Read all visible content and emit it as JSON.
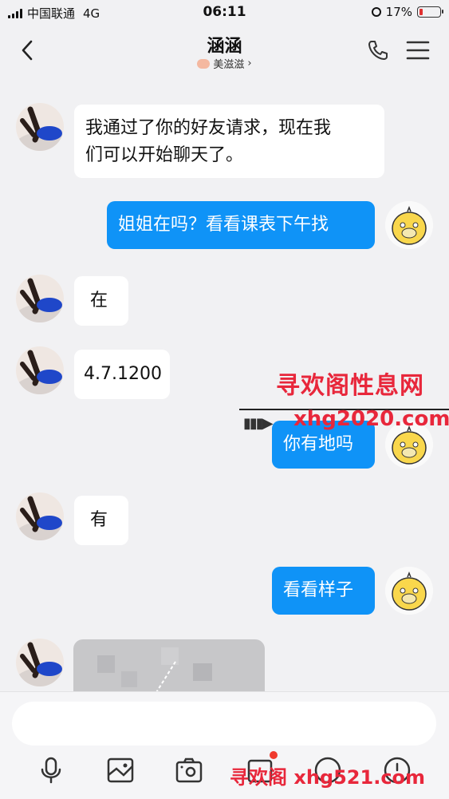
{
  "status_bar": {
    "carrier": "中国联通",
    "network": "4G",
    "time": "06:11",
    "battery": "17%",
    "battery_level": 0.17
  },
  "header": {
    "title": "涵涵",
    "subtitle": "美滋滋",
    "subtitle_chevron": "›"
  },
  "messages": [
    {
      "side": "in",
      "lines": [
        "我通过了你的好友请求，现在我",
        "们可以开始聊天了。"
      ]
    },
    {
      "side": "out",
      "text": "姐姐在吗？看看课表下午找"
    },
    {
      "side": "in",
      "text": "在"
    },
    {
      "side": "in",
      "text": "4.7.1200"
    },
    {
      "side": "out",
      "text": "你有地吗"
    },
    {
      "side": "in",
      "text": "有"
    },
    {
      "side": "out",
      "text": "看看样子"
    },
    {
      "side": "in",
      "type": "image"
    }
  ],
  "watermarks": {
    "cn": "寻欢阁性息网",
    "url": "xhg2020.com",
    "arrow": "▮▮▮▶",
    "bottom": "寻欢阁 xhg521.com"
  },
  "input": {
    "placeholder": ""
  },
  "icons": [
    "back-icon",
    "phone-icon",
    "menu-icon",
    "mic-icon",
    "image-icon",
    "camera-icon",
    "red-packet-icon",
    "emoji-icon",
    "plus-icon"
  ],
  "colors": {
    "bubble_out": "#0f93f7",
    "bubble_in": "#ffffff",
    "watermark": "#e8273b",
    "notification_dot": "#f03a2e"
  }
}
